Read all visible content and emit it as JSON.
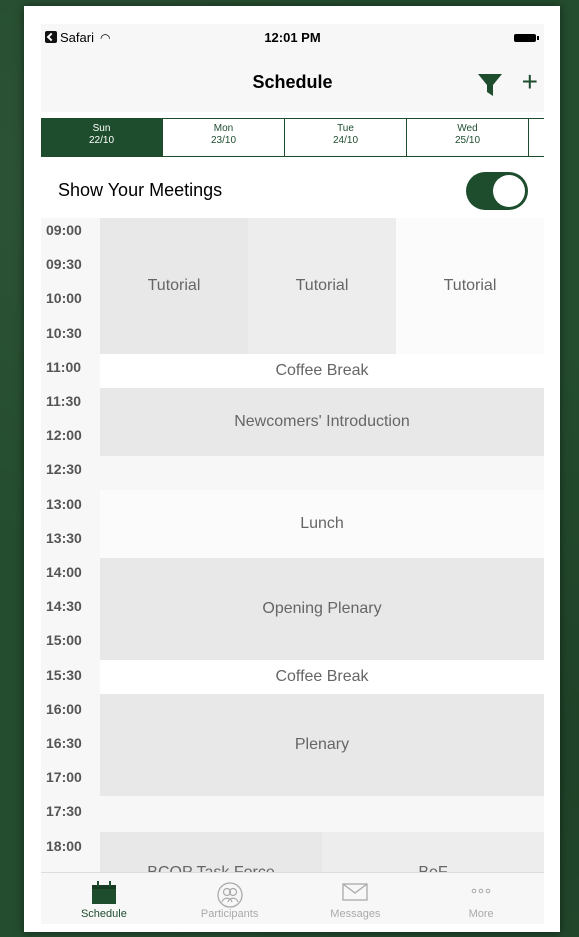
{
  "status": {
    "carrier": "Safari",
    "time": "12:01 PM"
  },
  "nav": {
    "title": "Schedule"
  },
  "days": [
    {
      "name": "Sun",
      "date": "22/10",
      "active": true
    },
    {
      "name": "Mon",
      "date": "23/10",
      "active": false
    },
    {
      "name": "Tue",
      "date": "24/10",
      "active": false
    },
    {
      "name": "Wed",
      "date": "25/10",
      "active": false
    }
  ],
  "meetings": {
    "label": "Show Your Meetings",
    "enabled": true
  },
  "times": [
    "09:00",
    "09:30",
    "10:00",
    "10:30",
    "11:00",
    "11:30",
    "12:00",
    "12:30",
    "13:00",
    "13:30",
    "14:00",
    "14:30",
    "15:00",
    "15:30",
    "16:00",
    "16:30",
    "17:00",
    "17:30",
    "18:00"
  ],
  "events": {
    "tutorial_sun": "Tutorial",
    "tutorial_mon": "Tutorial",
    "tutorial_tue": "Tutorial",
    "coffee1": "Coffee Break",
    "newcomers": "Newcomers' Introduction",
    "lunch": "Lunch",
    "opening": "Opening Plenary",
    "coffee2": "Coffee Break",
    "plenary": "Plenary",
    "bcop": "BCOP Task Force",
    "bof": "BoF"
  },
  "tabs": [
    {
      "label": "Schedule"
    },
    {
      "label": "Participants"
    },
    {
      "label": "Messages"
    },
    {
      "label": "More"
    }
  ],
  "colors": {
    "accent": "#1e4d2e",
    "background": "#244c2e",
    "event_grey": "#e8e8e8"
  }
}
